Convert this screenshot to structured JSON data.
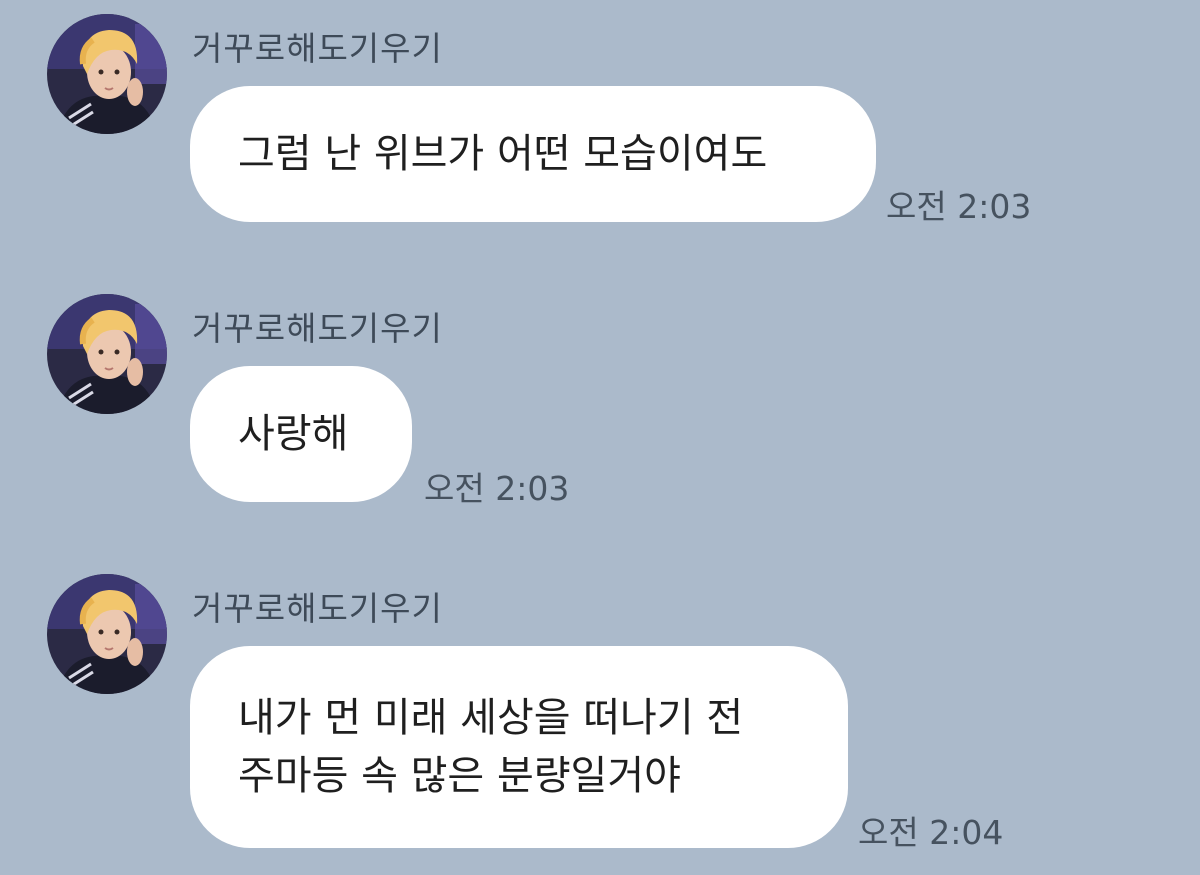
{
  "colors": {
    "background": "#abbacb",
    "bubble": "#ffffff",
    "sender_text": "#3e4a58",
    "time_text": "#46525f"
  },
  "messages": [
    {
      "sender": "거꾸로해도기우기",
      "avatar": "profile-photo",
      "lines": [
        "그럼 난 위브가 어떤 모습이여도"
      ],
      "time": "오전 2:03"
    },
    {
      "sender": "거꾸로해도기우기",
      "avatar": "profile-photo",
      "lines": [
        "사랑해"
      ],
      "time": "오전 2:03"
    },
    {
      "sender": "거꾸로해도기우기",
      "avatar": "profile-photo",
      "lines": [
        "내가 먼 미래 세상을 떠나기 전",
        "주마등 속 많은 분량일거야"
      ],
      "time": "오전 2:04"
    }
  ]
}
